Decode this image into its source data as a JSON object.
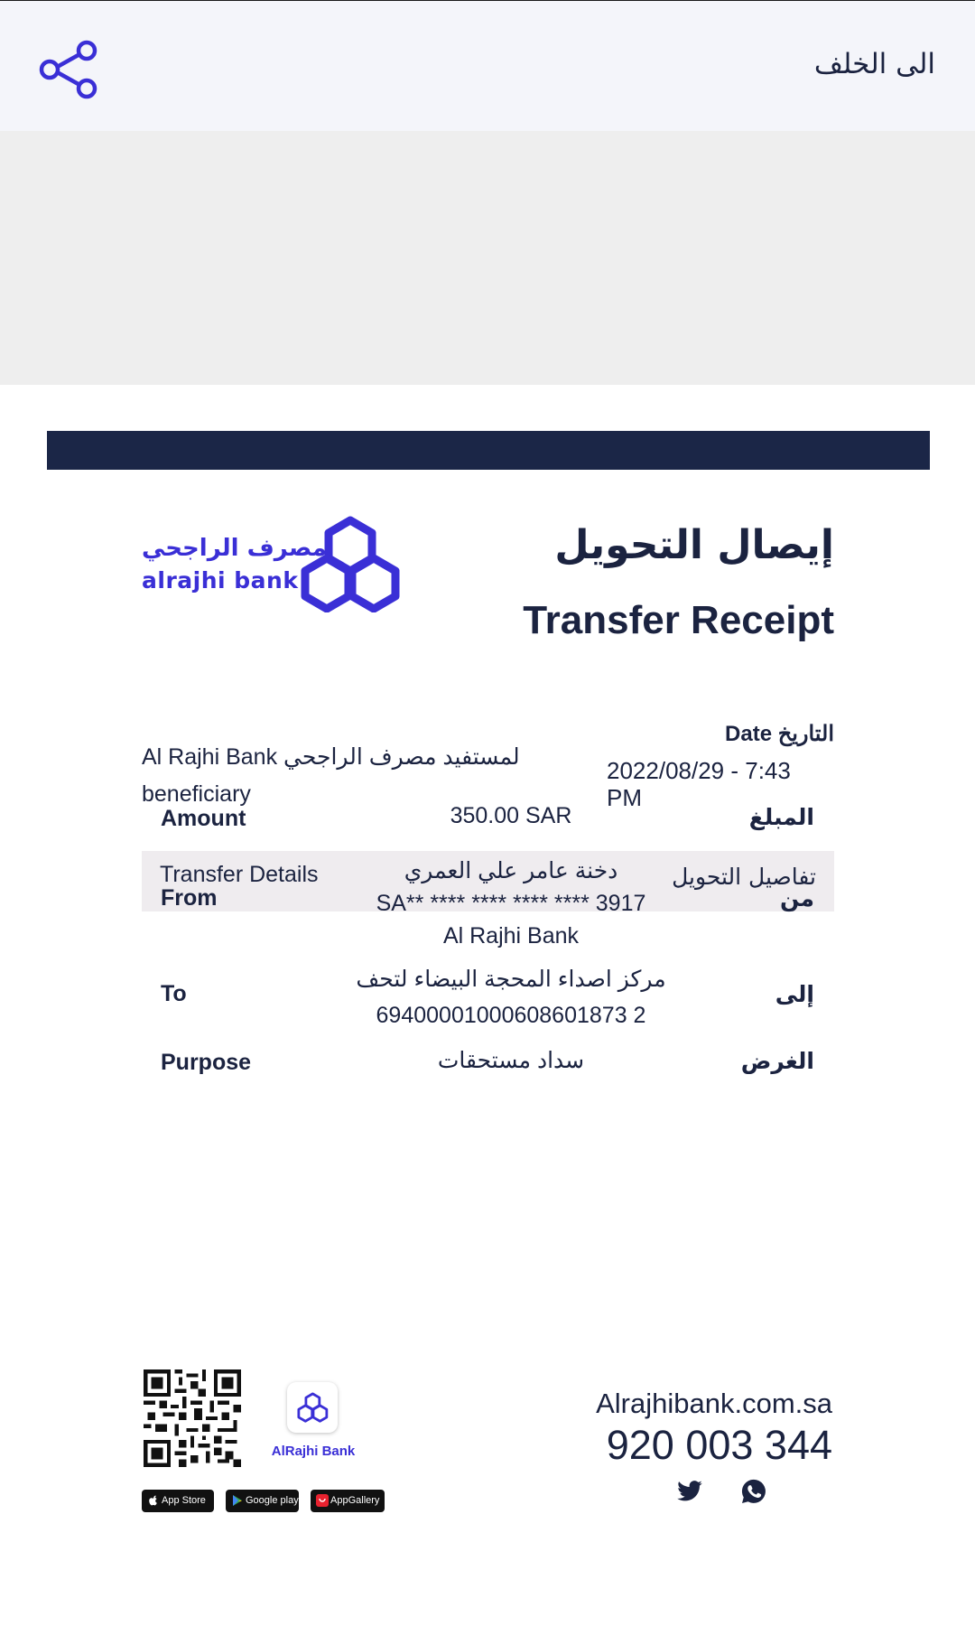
{
  "header": {
    "back_label": "الى الخلف",
    "share_icon": "share-icon"
  },
  "logo": {
    "arabic": "مصرف الراجحي",
    "english": "alrajhi bank"
  },
  "receipt": {
    "title_ar": "إيصال التحويل",
    "title_en": "Transfer Receipt",
    "beneficiary_text": "Al Rajhi Bank لمستفيد مصرف الراجحي beneficiary",
    "date_label": "Date التاريخ",
    "date_value": "2022/08/29 - 7:43 PM"
  },
  "details": {
    "header_en": "Transfer Details",
    "header_ar": "تفاصيل التحويل",
    "rows": [
      {
        "label_en": "Amount",
        "label_ar": "المبلغ",
        "lines": [
          "350.00 SAR"
        ]
      },
      {
        "label_en": "From",
        "label_ar": "من",
        "lines": [
          "دخنة عامر علي العمري",
          "SA** **** **** **** **** 3917",
          "Al Rajhi Bank"
        ]
      },
      {
        "label_en": "To",
        "label_ar": "إلى",
        "lines": [
          "مركز اصداء المحجة البيضاء لتحف",
          "69400001000608601873 2"
        ]
      },
      {
        "label_en": "Purpose",
        "label_ar": "الغرض",
        "lines": [
          "سداد مستحقات"
        ]
      }
    ]
  },
  "footer": {
    "app_label": "AlRajhi Bank",
    "stores": [
      "App Store",
      "Google play",
      "AppGallery"
    ],
    "website": "Alrajhibank.com.sa",
    "phone": "920 003 344",
    "social_icons": [
      "twitter-icon",
      "whatsapp-icon"
    ]
  },
  "colors": {
    "navy": "#1b2647",
    "brand_purple": "#3a2fd6",
    "topbar_bg": "#f4f5fa",
    "details_header_bg": "#efecef"
  }
}
